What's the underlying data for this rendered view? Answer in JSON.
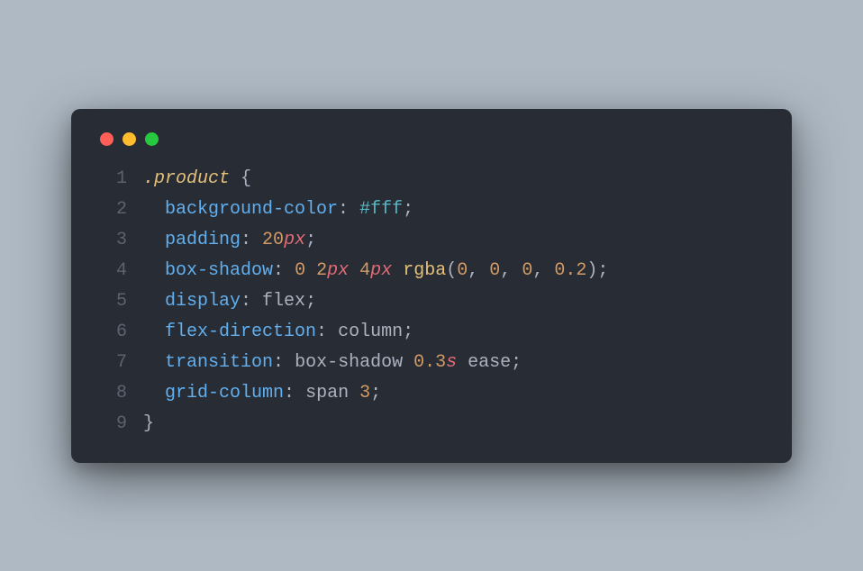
{
  "window": {
    "dots": [
      "red",
      "yellow",
      "green"
    ]
  },
  "code": {
    "selector": ".product",
    "open": "{",
    "close": "}",
    "semi": ";",
    "colon": ":",
    "sp": " ",
    "comma": ",",
    "lparen": "(",
    "rparen": ")",
    "hash": "#",
    "lines": {
      "l1_num": "1",
      "l2_num": "2",
      "l3_num": "3",
      "l4_num": "4",
      "l5_num": "5",
      "l6_num": "6",
      "l7_num": "7",
      "l8_num": "8",
      "l9_num": "9"
    },
    "props": {
      "bgcolor": "background-color",
      "padding": "padding",
      "boxshadow": "box-shadow",
      "display": "display",
      "flexdir": "flex-direction",
      "transition": "transition",
      "gridcol": "grid-column"
    },
    "vals": {
      "hex_fff": "fff",
      "n20": "20",
      "px": "px",
      "n0": "0",
      "n2": "2",
      "n4": "4",
      "rgba": "rgba",
      "n0b": "0",
      "n0c": "0",
      "n0d": "0",
      "n02": "0.2",
      "flex": "flex",
      "column": "column",
      "boxshadow_word": "box-shadow",
      "n03": "0.3",
      "s": "s",
      "ease": "ease",
      "span": "span",
      "n3": "3"
    }
  }
}
